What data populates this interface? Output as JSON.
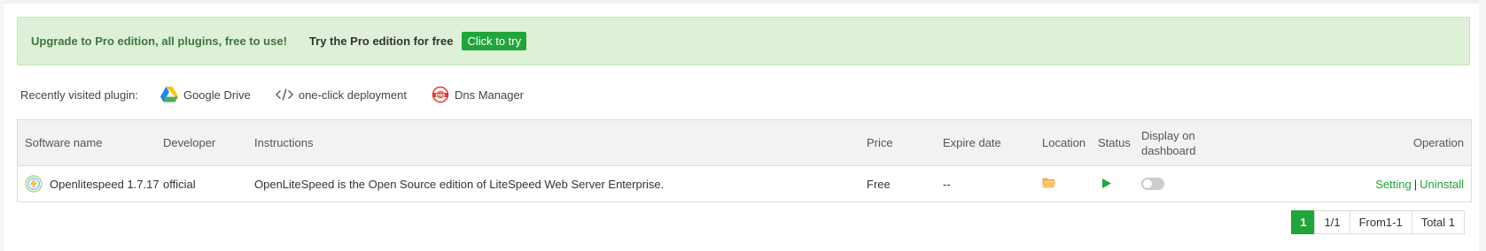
{
  "banner": {
    "upgrade_text": "Upgrade to Pro edition, all plugins, free to use!",
    "try_text": "Try the Pro edition for free",
    "button_label": "Click to try"
  },
  "recent": {
    "label": "Recently visited plugin:",
    "plugins": [
      {
        "name": "Google Drive",
        "icon": "google-drive-icon"
      },
      {
        "name": "one-click deployment",
        "icon": "code-icon"
      },
      {
        "name": "Dns Manager",
        "icon": "dns-icon"
      }
    ]
  },
  "table": {
    "headers": {
      "name": "Software name",
      "developer": "Developer",
      "instructions": "Instructions",
      "price": "Price",
      "expire": "Expire date",
      "location": "Location",
      "status": "Status",
      "display_line1": "Display on",
      "display_line2": "dashboard",
      "operation": "Operation"
    },
    "rows": [
      {
        "name": "Openlitespeed 1.7.17",
        "developer": "official",
        "instructions": "OpenLiteSpeed is the Open Source edition of LiteSpeed Web Server Enterprise.",
        "price": "Free",
        "expire": "--",
        "location_icon": "folder-icon",
        "status_icon": "play-icon",
        "display_on_dashboard": false,
        "op_setting": "Setting",
        "op_separator": "|",
        "op_uninstall": "Uninstall"
      }
    ]
  },
  "pager": {
    "current": "1",
    "pages": "1/1",
    "range": "From1-1",
    "total": "Total 1"
  },
  "colors": {
    "accent": "#20a53a",
    "banner_bg": "#dff0d8",
    "banner_text": "#3c763d",
    "folder": "#f0ad4e"
  }
}
